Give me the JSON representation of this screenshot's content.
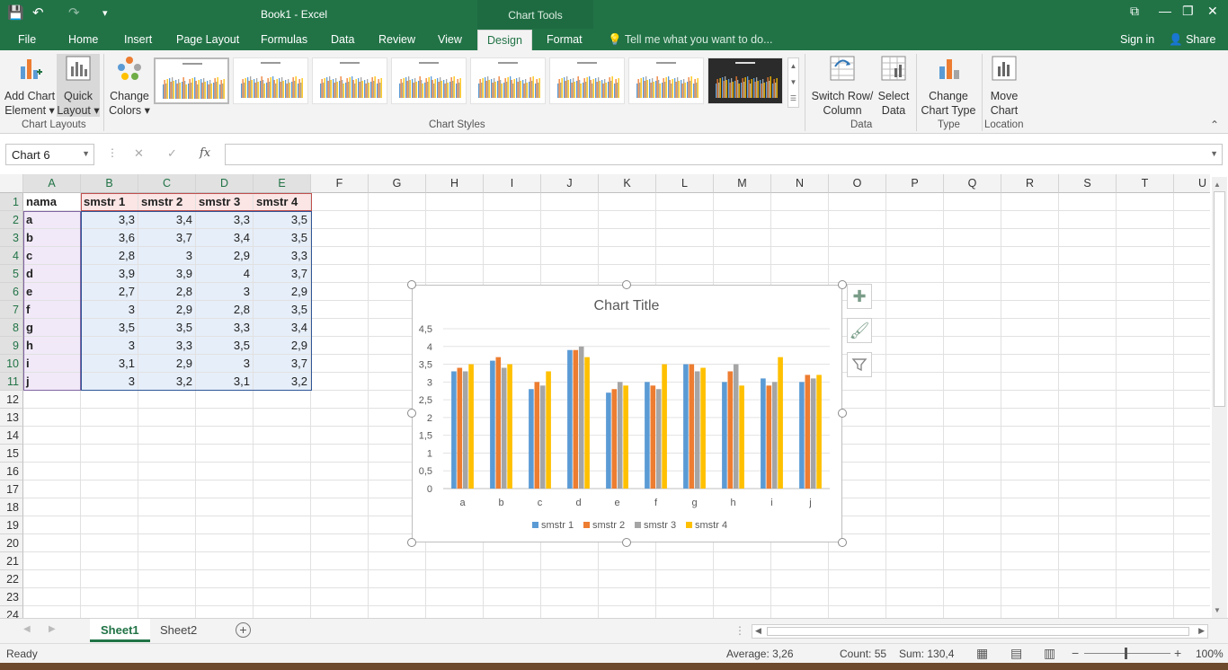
{
  "window": {
    "title": "Book1 - Excel",
    "context_tab": "Chart Tools"
  },
  "quick_access": {
    "save": "💾",
    "undo": "↶",
    "redo": "↷",
    "more": "▾"
  },
  "tabs": [
    "File",
    "Home",
    "Insert",
    "Page Layout",
    "Formulas",
    "Data",
    "Review",
    "View",
    "Design",
    "Format"
  ],
  "tell_me": "Tell me what you want to do...",
  "account": {
    "signin": "Sign in",
    "share": "Share"
  },
  "ribbon": {
    "add_chart_element": {
      "line1": "Add Chart",
      "line2": "Element ▾"
    },
    "quick_layout": {
      "line1": "Quick",
      "line2": "Layout ▾"
    },
    "change_colors": {
      "line1": "Change",
      "line2": "Colors ▾"
    },
    "switch_row_col": {
      "line1": "Switch Row/",
      "line2": "Column"
    },
    "select_data": {
      "line1": "Select",
      "line2": "Data"
    },
    "change_chart_type": {
      "line1": "Change",
      "line2": "Chart Type"
    },
    "move_chart": {
      "line1": "Move",
      "line2": "Chart"
    },
    "groups": {
      "chart_layouts": "Chart Layouts",
      "chart_styles": "Chart Styles",
      "data": "Data",
      "type": "Type",
      "location": "Location"
    }
  },
  "formula_bar": {
    "name_box": "Chart 6",
    "fx": "fx",
    "cancel": "✕",
    "enter": "✓"
  },
  "columns": [
    "A",
    "B",
    "C",
    "D",
    "E",
    "F",
    "G",
    "H",
    "I",
    "J",
    "K",
    "L",
    "M",
    "N",
    "O",
    "P",
    "Q",
    "R",
    "S",
    "T",
    "U"
  ],
  "rows": [
    "1",
    "2",
    "3",
    "4",
    "5",
    "6",
    "7",
    "8",
    "9",
    "10",
    "11",
    "12",
    "13",
    "14",
    "15",
    "16",
    "17",
    "18",
    "19",
    "20",
    "21",
    "22",
    "23",
    "24"
  ],
  "sheet": {
    "headers": [
      "nama",
      "smstr 1",
      "smstr 2",
      "smstr 3",
      "smstr 4"
    ],
    "data": [
      [
        "a",
        "3,3",
        "3,4",
        "3,3",
        "3,5"
      ],
      [
        "b",
        "3,6",
        "3,7",
        "3,4",
        "3,5"
      ],
      [
        "c",
        "2,8",
        "3",
        "2,9",
        "3,3"
      ],
      [
        "d",
        "3,9",
        "3,9",
        "4",
        "3,7"
      ],
      [
        "e",
        "2,7",
        "2,8",
        "3",
        "2,9"
      ],
      [
        "f",
        "3",
        "2,9",
        "2,8",
        "3,5"
      ],
      [
        "g",
        "3,5",
        "3,5",
        "3,3",
        "3,4"
      ],
      [
        "h",
        "3",
        "3,3",
        "3,5",
        "2,9"
      ],
      [
        "i",
        "3,1",
        "2,9",
        "3",
        "3,7"
      ],
      [
        "j",
        "3",
        "3,2",
        "3,1",
        "3,2"
      ]
    ]
  },
  "chart_data": {
    "type": "bar",
    "title": "Chart Title",
    "categories": [
      "a",
      "b",
      "c",
      "d",
      "e",
      "f",
      "g",
      "h",
      "i",
      "j"
    ],
    "series": [
      {
        "name": "smstr 1",
        "color": "#5b9bd5",
        "values": [
          3.3,
          3.6,
          2.8,
          3.9,
          2.7,
          3,
          3.5,
          3,
          3.1,
          3
        ]
      },
      {
        "name": "smstr 2",
        "color": "#ed7d31",
        "values": [
          3.4,
          3.7,
          3,
          3.9,
          2.8,
          2.9,
          3.5,
          3.3,
          2.9,
          3.2
        ]
      },
      {
        "name": "smstr 3",
        "color": "#a5a5a5",
        "values": [
          3.3,
          3.4,
          2.9,
          4,
          3,
          2.8,
          3.3,
          3.5,
          3,
          3.1
        ]
      },
      {
        "name": "smstr 4",
        "color": "#ffc000",
        "values": [
          3.5,
          3.5,
          3.3,
          3.7,
          2.9,
          3.5,
          3.4,
          2.9,
          3.7,
          3.2
        ]
      }
    ],
    "y_ticks": [
      "0",
      "0,5",
      "1",
      "1,5",
      "2",
      "2,5",
      "3",
      "3,5",
      "4",
      "4,5"
    ],
    "ylim": [
      0,
      4.5
    ],
    "grid": true,
    "legend": "bottom"
  },
  "sheets": {
    "tab1": "Sheet1",
    "tab2": "Sheet2",
    "add": "+"
  },
  "status": {
    "ready": "Ready",
    "average": "Average: 3,26",
    "count": "Count: 55",
    "sum": "Sum: 130,4",
    "zoom": "100%"
  },
  "colors": {
    "excel_green": "#217346",
    "ribbon_bg": "#f3f3f3"
  }
}
